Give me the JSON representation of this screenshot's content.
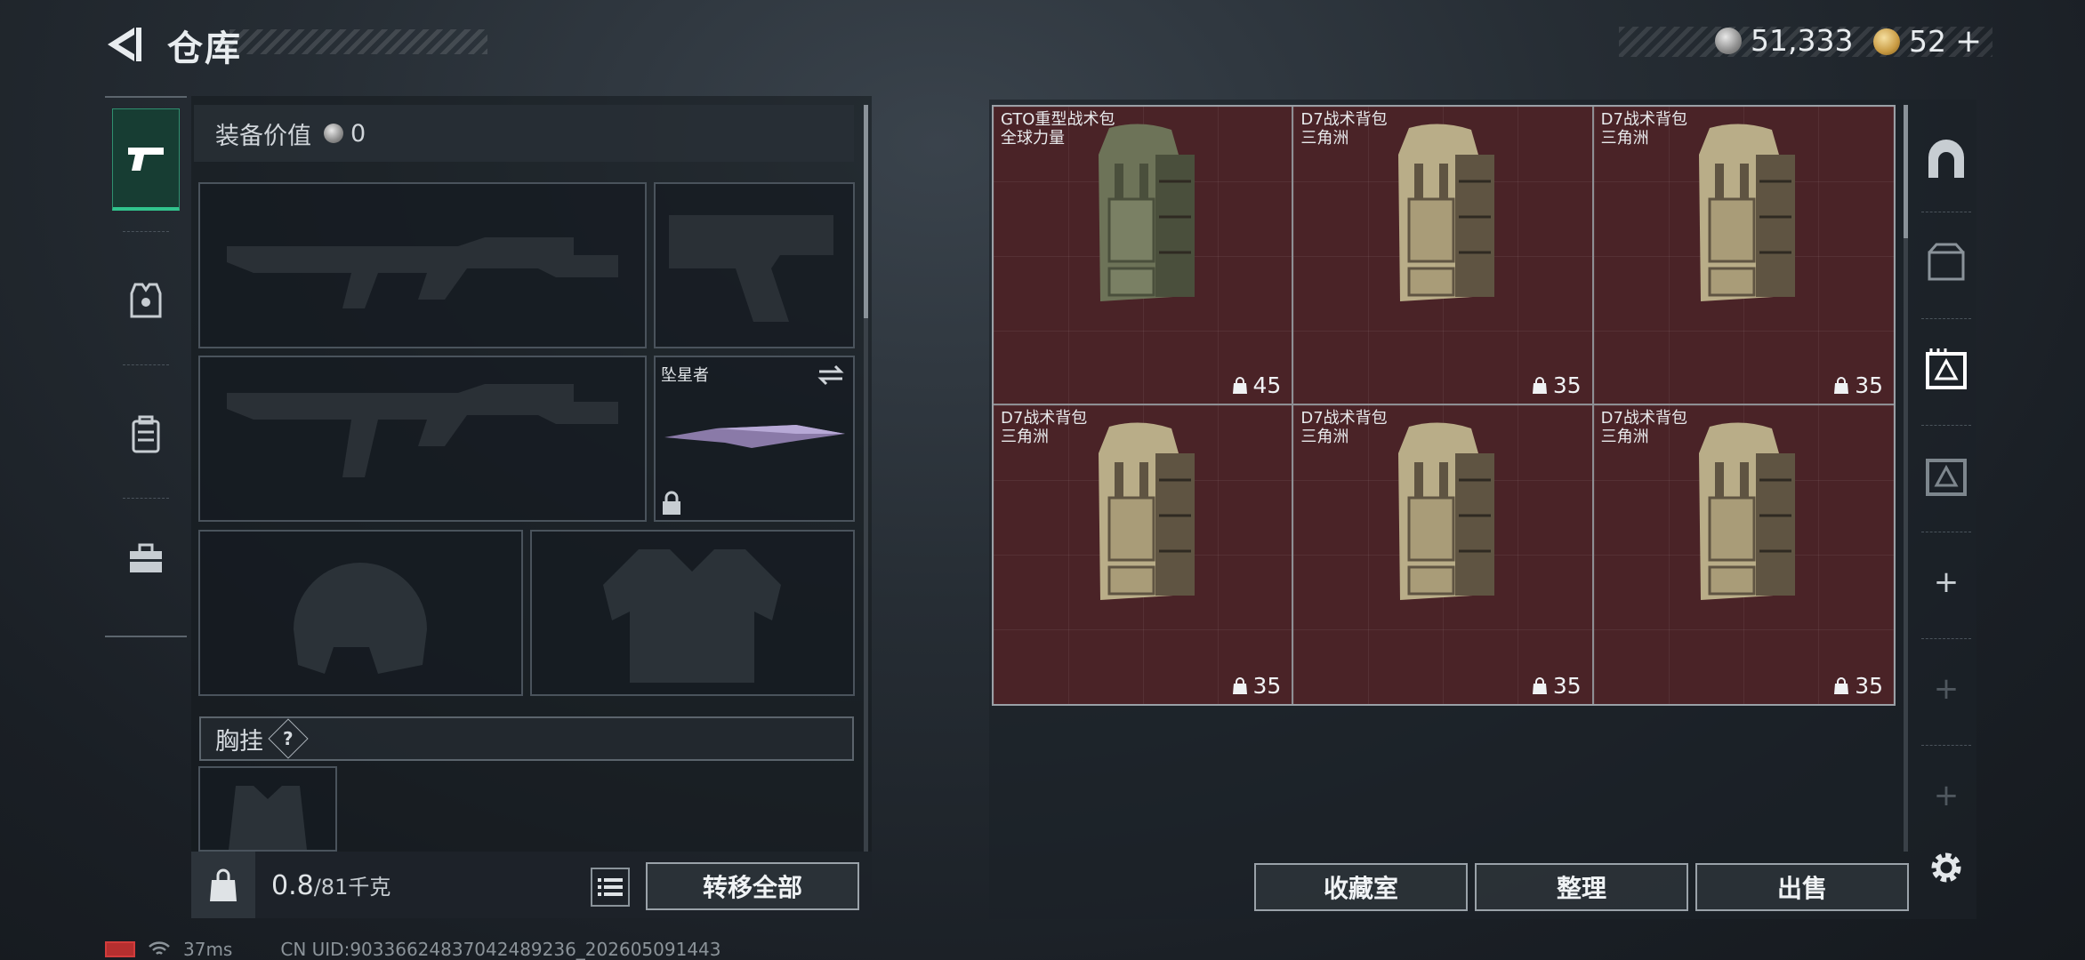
{
  "header": {
    "title": "仓库",
    "currencies": [
      {
        "icon": "silver-coin-icon",
        "amount": "51,333"
      },
      {
        "icon": "gold-coin-icon",
        "amount": "52"
      }
    ],
    "gold_plus": "+"
  },
  "left_rail": {
    "items": [
      {
        "icon": "pistol-icon",
        "active": true
      },
      {
        "icon": "armor-vest-icon",
        "active": false
      },
      {
        "icon": "backpack-icon",
        "active": false
      },
      {
        "icon": "toolbox-icon",
        "active": false
      }
    ]
  },
  "equipment": {
    "value_label": "装备价值",
    "value": "0",
    "melee_name": "坠星者",
    "chest_label": "胸挂",
    "help": "?"
  },
  "bottom_left": {
    "weight_current": "0.8",
    "weight_max": "/81千克",
    "transfer_all": "转移全部"
  },
  "inventory": {
    "items": [
      {
        "name": "GTO重型战术包",
        "sub": "全球力量",
        "capacity": "45",
        "tone": "green"
      },
      {
        "name": "D7战术背包",
        "sub": "三角洲",
        "capacity": "35",
        "tone": "tan"
      },
      {
        "name": "D7战术背包",
        "sub": "三角洲",
        "capacity": "35",
        "tone": "tan"
      },
      {
        "name": "D7战术背包",
        "sub": "三角洲",
        "capacity": "35",
        "tone": "tan"
      },
      {
        "name": "D7战术背包",
        "sub": "三角洲",
        "capacity": "35",
        "tone": "tan"
      },
      {
        "name": "D7战术背包",
        "sub": "三角洲",
        "capacity": "35",
        "tone": "tan"
      }
    ],
    "buttons": {
      "collection": "收藏室",
      "organize": "整理",
      "sell": "出售"
    }
  },
  "right_rail": {
    "plus": "+"
  },
  "status": {
    "ping": "37ms",
    "uid": "CN UID:90336624837042489236_202605091443"
  },
  "colors": {
    "accent_green": "#31c48d",
    "cell_red": "#4a2327"
  }
}
